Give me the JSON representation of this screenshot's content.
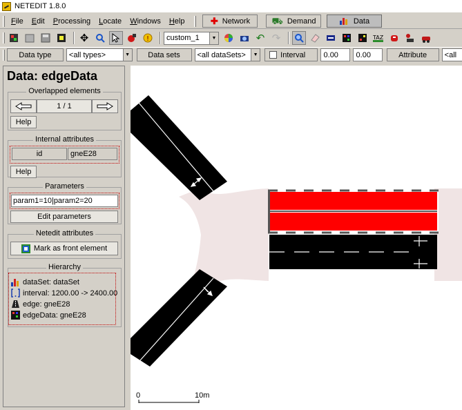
{
  "app": {
    "title": "NETEDIT 1.8.0"
  },
  "menu": {
    "items": [
      {
        "u": "F",
        "rest": "ile"
      },
      {
        "u": "E",
        "rest": "dit"
      },
      {
        "u": "P",
        "rest": "rocessing"
      },
      {
        "u": "L",
        "rest": "ocate"
      },
      {
        "u": "W",
        "rest": "indows"
      },
      {
        "u": "H",
        "rest": "elp"
      }
    ],
    "modes": [
      {
        "label": "Network",
        "icon": "network-icon"
      },
      {
        "label": "Demand",
        "icon": "demand-icon"
      },
      {
        "label": "Data",
        "icon": "data-icon"
      }
    ]
  },
  "toolbar": {
    "scheme_select": "custom_1"
  },
  "filter": {
    "data_type_button": "Data type",
    "data_type_value": "<all types>",
    "data_sets_button": "Data sets",
    "data_sets_value": "<all dataSets>",
    "interval_label": "Interval",
    "interval_begin": "0.00",
    "interval_end": "0.00",
    "attribute_button": "Attribute",
    "attribute_value": "<all"
  },
  "frame": {
    "title": "Data: edgeData",
    "overlapped": {
      "title": "Overlapped elements",
      "counter": "1 / 1",
      "help": "Help"
    },
    "internal": {
      "title": "Internal attributes",
      "attr_name": "id",
      "attr_value": "gneE28",
      "help": "Help"
    },
    "parameters": {
      "title": "Parameters",
      "value": "param1=10|param2=20",
      "edit": "Edit parameters"
    },
    "netedit": {
      "title": "Netedit attributes",
      "front_button": "Mark as front element"
    },
    "hierarchy": {
      "title": "Hierarchy",
      "items": [
        {
          "label": "dataSet: dataSet",
          "icon": "dataset-icon"
        },
        {
          "label": "interval: 1200.00 -> 2400.00",
          "icon": "interval-icon"
        },
        {
          "label": "edge: gneE28",
          "icon": "edge-icon"
        },
        {
          "label": "edgeData: gneE28",
          "icon": "edgedata-icon"
        }
      ]
    }
  },
  "canvas": {
    "scale_start": "0",
    "scale_end": "10m"
  },
  "colors": {
    "selected_edge": "#ff0000",
    "junction": "#f0e4e4",
    "lane": "#000000"
  }
}
